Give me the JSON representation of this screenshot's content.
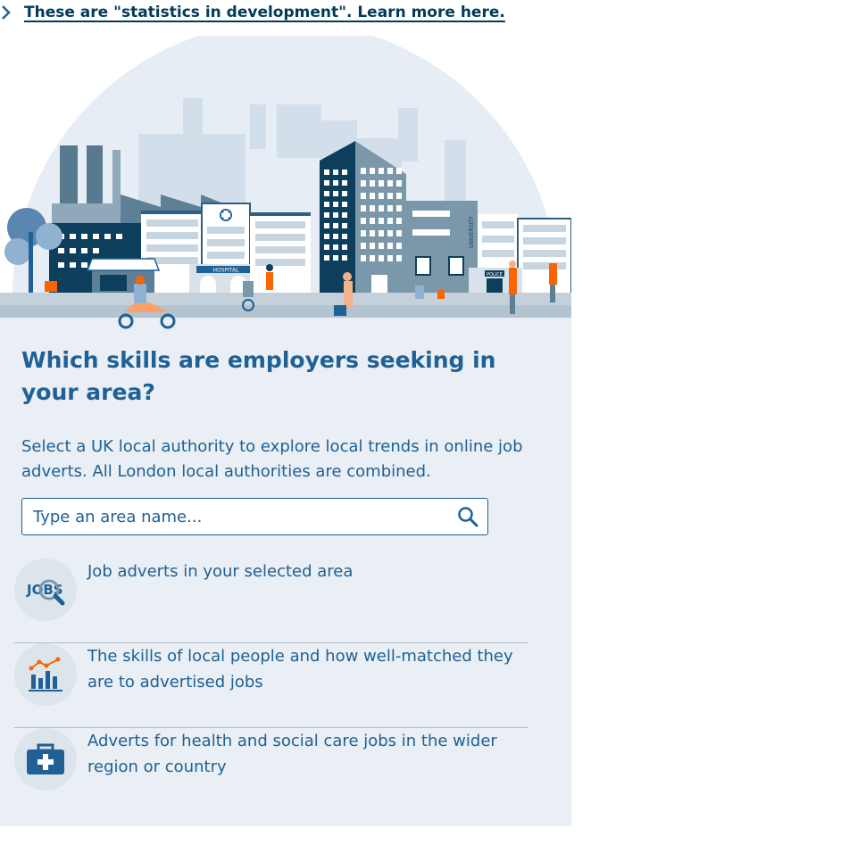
{
  "banner": {
    "link_text": "These are \"statistics in development\". Learn more here."
  },
  "hero": {
    "hospital_sign": "HOSPITAL",
    "university_sign": "UNIVERSITY",
    "police_sign": "POLICE"
  },
  "main": {
    "title": "Which skills are employers seeking in your area?",
    "intro": "Select a UK local authority to explore local trends in online job adverts. All London local authorities are combined.",
    "search": {
      "placeholder": "Type an area name...",
      "value": ""
    }
  },
  "features": [
    {
      "icon": "jobs-search-icon",
      "icon_text": "JOBS",
      "text": "Job adverts in your selected area"
    },
    {
      "icon": "chart-icon",
      "text": "The skills of local people and how well-matched they are to advertised jobs"
    },
    {
      "icon": "medical-bag-icon",
      "text": "Adverts for health and social care jobs in the wider region or country"
    }
  ],
  "colors": {
    "primary": "#206095",
    "dark": "#003c57",
    "accent": "#f66068",
    "orange": "#fa6401",
    "panel": "#e9eff4"
  }
}
